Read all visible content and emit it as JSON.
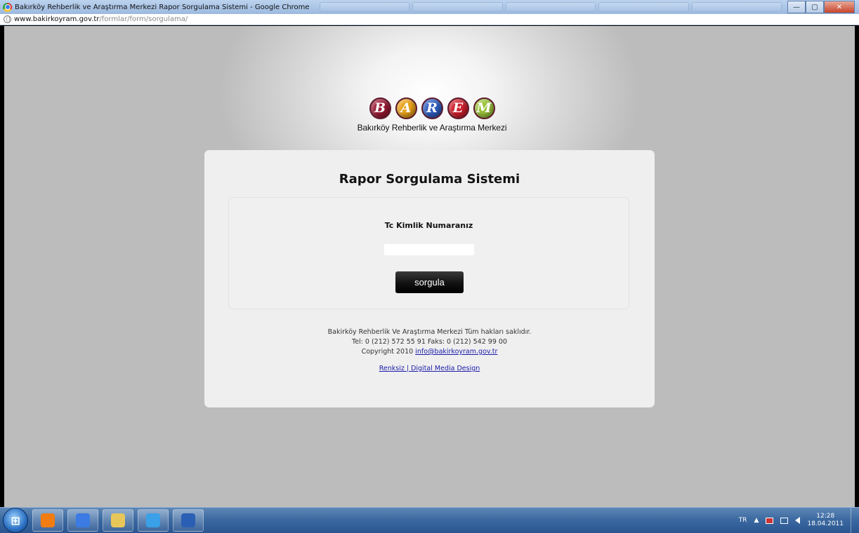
{
  "window": {
    "title": "Bakırköy Rehberlik ve Araştırma Merkezi Rapor Sorgulama Sistemi - Google Chrome",
    "minimize_glyph": "—",
    "maximize_glyph": "▢",
    "close_glyph": "✕"
  },
  "address": {
    "host": "www.bakirkoyram.gov.tr",
    "path": "/formlar/form/sorgulama/"
  },
  "logo": {
    "letters": [
      "B",
      "A",
      "R",
      "E",
      "M"
    ],
    "letter_colors": [
      "#9b1b34",
      "#e8a21a",
      "#2e5dbf",
      "#cf1f2d",
      "#9bc23a"
    ],
    "subtitle": "Bakırköy Rehberlik ve Araştırma Merkezi"
  },
  "form": {
    "title": "Rapor Sorgulama Sistemi",
    "field_label": "Tc Kimlik Numaranız",
    "input_value": "",
    "submit_label": "sorgula"
  },
  "footer": {
    "line1": "Bakirköy Rehberlik Ve Araştırma Merkezi Tüm hakları saklıdır.",
    "line2": "Tel: 0 (212) 572 55 91 Faks: 0 (212) 542 99 00",
    "line3_prefix": "Copyright 2010 ",
    "email": "info@bakirkoyram.gov.tr",
    "credit": "Renksiz | Digital Media Design"
  },
  "taskbar": {
    "start_glyph": "⊞",
    "apps": [
      {
        "name": "media-player-icon",
        "color": "#f07c12"
      },
      {
        "name": "chrome-icon",
        "color": "#3b7be3"
      },
      {
        "name": "file-explorer-icon",
        "color": "#e8c75a"
      },
      {
        "name": "internet-explorer-icon",
        "color": "#3aa0e8"
      },
      {
        "name": "word-icon",
        "color": "#2b5fb4"
      }
    ],
    "language": "TR",
    "tray_arrow": "▲",
    "time": "12:28",
    "date": "18.04.2011"
  }
}
